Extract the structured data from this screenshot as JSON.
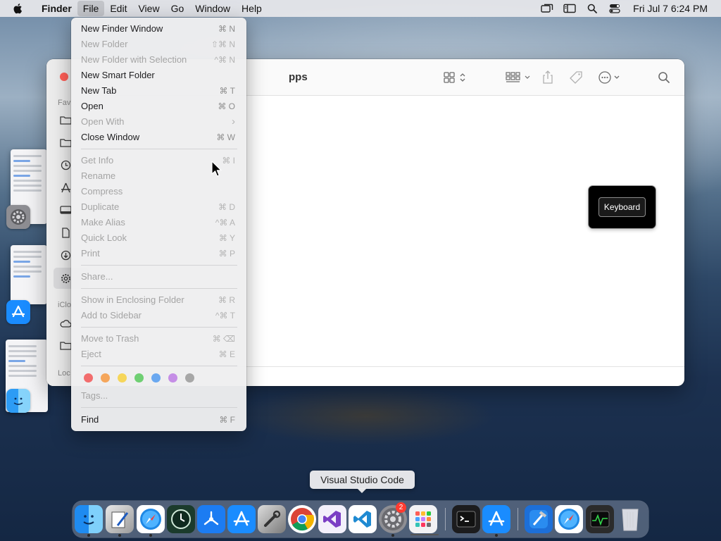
{
  "menubar": {
    "app_name": "Finder",
    "menus": [
      "File",
      "Edit",
      "View",
      "Go",
      "Window",
      "Help"
    ],
    "active_menu": "File",
    "status_icons": [
      "screen-mirror-icon",
      "sidebar-display-icon",
      "spotlight-search-icon",
      "control-center-icon"
    ],
    "clock": "Fri Jul 7  6:24 PM"
  },
  "file_menu": {
    "items": [
      {
        "label": "New Finder Window",
        "shortcut": "⌘ N",
        "enabled": true
      },
      {
        "label": "New Folder",
        "shortcut": "⇧⌘ N",
        "enabled": false
      },
      {
        "label": "New Folder with Selection",
        "shortcut": "^⌘ N",
        "enabled": false
      },
      {
        "label": "New Smart Folder",
        "shortcut": "",
        "enabled": true
      },
      {
        "label": "New Tab",
        "shortcut": "⌘ T",
        "enabled": true
      },
      {
        "label": "Open",
        "shortcut": "⌘ O",
        "enabled": true
      },
      {
        "label": "Open With",
        "shortcut": "›",
        "enabled": false
      },
      {
        "label": "Close Window",
        "shortcut": "⌘ W",
        "enabled": true
      },
      {
        "label": "Get Info",
        "shortcut": "⌘ I",
        "enabled": false
      },
      {
        "label": "Rename",
        "shortcut": "",
        "enabled": false
      },
      {
        "label": "Compress",
        "shortcut": "",
        "enabled": false
      },
      {
        "label": "Duplicate",
        "shortcut": "⌘ D",
        "enabled": false
      },
      {
        "label": "Make Alias",
        "shortcut": "^⌘ A",
        "enabled": false
      },
      {
        "label": "Quick Look",
        "shortcut": "⌘ Y",
        "enabled": false
      },
      {
        "label": "Print",
        "shortcut": "⌘ P",
        "enabled": false
      },
      {
        "label": "Share...",
        "shortcut": "",
        "enabled": false
      },
      {
        "label": "Show in Enclosing Folder",
        "shortcut": "⌘ R",
        "enabled": false
      },
      {
        "label": "Add to Sidebar",
        "shortcut": "^⌘ T",
        "enabled": false
      },
      {
        "label": "Move to Trash",
        "shortcut": "⌘ ⌫",
        "enabled": false
      },
      {
        "label": "Eject",
        "shortcut": "⌘ E",
        "enabled": false
      },
      {
        "label": "Tags...",
        "shortcut": "",
        "enabled": false
      },
      {
        "label": "Find",
        "shortcut": "⌘ F",
        "enabled": true
      }
    ],
    "tag_colors": [
      "#f26d6d",
      "#f5a65b",
      "#f6d65a",
      "#6fcf73",
      "#6aa8f0",
      "#c58ee6",
      "#a7a7a7"
    ]
  },
  "finder_window": {
    "title": "pps",
    "sidebar_labels": {
      "favorites": "Fav",
      "icloud": "iClo",
      "locations": "Loc"
    },
    "keyboard_tile_label": "Keyboard"
  },
  "dock": {
    "tooltip": "Visual Studio Code",
    "badge_count": "2",
    "apps": [
      "finder",
      "sketchbook",
      "safari",
      "time-machine",
      "testflight",
      "app-store",
      "system-toolbox",
      "chrome",
      "visual-studio",
      "vscode",
      "system-settings",
      "launchpad",
      "terminal",
      "app-store-2",
      "xcode",
      "safari-2",
      "activity-monitor",
      "trash"
    ]
  },
  "colors": {
    "accent": "#0a84ff",
    "close": "#ff5f57",
    "badge": "#ff3b30"
  }
}
